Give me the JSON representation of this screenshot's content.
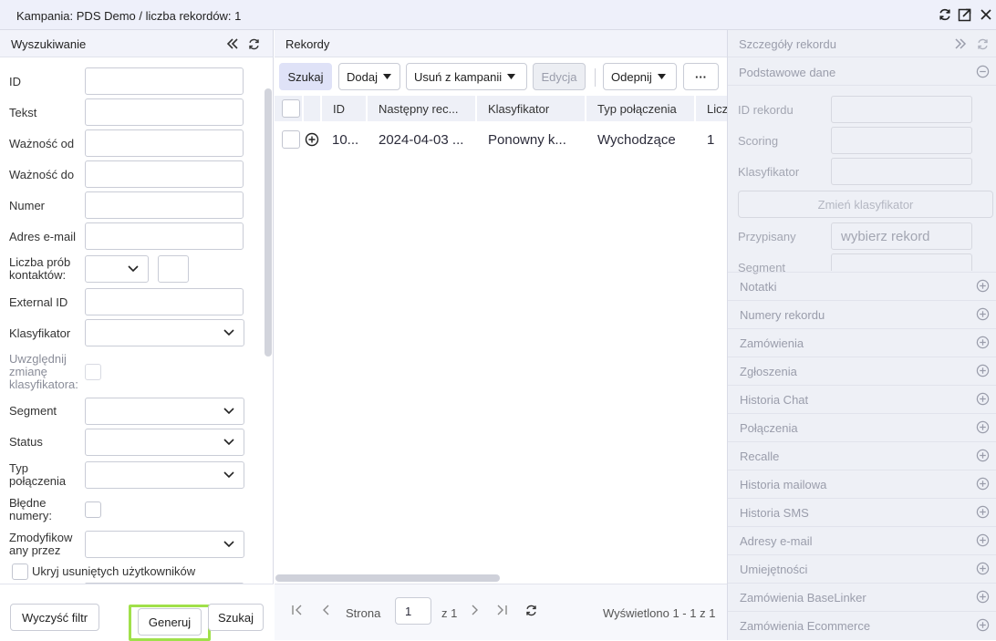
{
  "window": {
    "title": "Kampania: PDS Demo / liczba rekordów: 1"
  },
  "search_panel": {
    "title": "Wyszukiwanie",
    "fields": {
      "id": "ID",
      "text": "Tekst",
      "valid_from": "Ważność od",
      "valid_to": "Ważność do",
      "number": "Numer",
      "email": "Adres e-mail",
      "attempts_line1": "Liczba prób",
      "attempts_line2": "kontaktów:",
      "external_id": "External ID",
      "classifier": "Klasyfikator",
      "include_line1": "Uwzględnij",
      "include_line2": "zmianę",
      "include_line3": "klasyfikatora:",
      "segment": "Segment",
      "status": "Status",
      "conn_type_line1": "Typ",
      "conn_type_line2": "połączenia",
      "bad_numbers_line1": "Błędne",
      "bad_numbers_line2": "numery:",
      "modified_line1": "Zmodyfikow",
      "modified_line2": "any przez",
      "hide_deleted": "Ukryj usuniętych użytkowników"
    },
    "footer": {
      "clear": "Wyczyść filtr",
      "generate": "Generuj",
      "search": "Szukaj"
    }
  },
  "records_panel": {
    "title": "Rekordy",
    "toolbar": {
      "search": "Szukaj",
      "add": "Dodaj",
      "remove": "Usuń z kampanii",
      "edit": "Edycja",
      "unpin": "Odepnij",
      "more": "···"
    },
    "columns": [
      "ID",
      "Następny rec...",
      "Klasyfikator",
      "Typ połączenia",
      "Licz"
    ],
    "rows": [
      {
        "id": "10...",
        "next": "2024-04-03 ...",
        "classifier": "Ponowny k...",
        "type": "Wychodzące",
        "count": "1"
      }
    ],
    "pager": {
      "page_label": "Strona",
      "page": "1",
      "of": "z 1",
      "shown": "Wyświetlono 1 - 1 z 1"
    }
  },
  "details_panel": {
    "title": "Szczegóły rekordu",
    "basic_section": "Podstawowe dane",
    "fields": {
      "record_id": "ID rekordu",
      "scoring": "Scoring",
      "classifier": "Klasyfikator",
      "change_classifier": "Zmień klasyfikator",
      "assigned": "Przypisany",
      "assigned_placeholder": "wybierz rekord",
      "segment": "Segment"
    },
    "sections": [
      "Notatki",
      "Numery rekordu",
      "Zamówienia",
      "Zgłoszenia",
      "Historia Chat",
      "Połączenia",
      "Recalle",
      "Historia mailowa",
      "Historia SMS",
      "Adresy e-mail",
      "Umiejętności",
      "Zamówienia BaseLinker",
      "Zamówienia Ecommerce"
    ]
  },
  "colors": {
    "accent": "#dfe2f7",
    "highlight": "#a0e04a",
    "panel_bg": "#eef0f6"
  }
}
